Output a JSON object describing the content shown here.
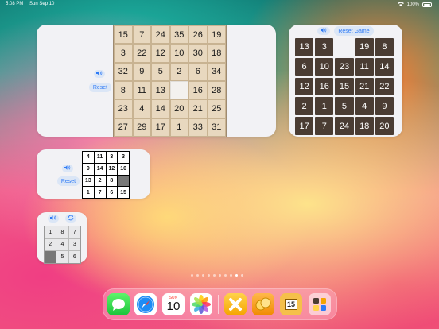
{
  "status_bar": {
    "time": "5:08 PM",
    "date": "Sun Sep 10",
    "battery": "100%"
  },
  "widget1": {
    "reset_label": "Reset",
    "board": [
      "15",
      "7",
      "24",
      "35",
      "26",
      "19",
      "3",
      "22",
      "12",
      "10",
      "30",
      "18",
      "32",
      "9",
      "5",
      "2",
      "6",
      "34",
      "8",
      "11",
      "13",
      "",
      "16",
      "28",
      "23",
      "4",
      "14",
      "20",
      "21",
      "25",
      "27",
      "29",
      "17",
      "1",
      "33",
      "31"
    ]
  },
  "widget2": {
    "reset_label": "Reset Game",
    "board": [
      "13",
      "3",
      "",
      "19",
      "8",
      "6",
      "10",
      "23",
      "11",
      "14",
      "12",
      "16",
      "15",
      "21",
      "22",
      "2",
      "1",
      "5",
      "4",
      "9",
      "17",
      "7",
      "24",
      "18",
      "20"
    ]
  },
  "widget3": {
    "reset_label": "Reset",
    "board": [
      "4",
      "11",
      "3",
      "3",
      "9",
      "14",
      "12",
      "10",
      "13",
      "2",
      "8",
      "",
      "1",
      "7",
      "6",
      "15"
    ]
  },
  "widget4": {
    "board": [
      "1",
      "8",
      "7",
      "2",
      "4",
      "3",
      "",
      "5",
      "6"
    ]
  },
  "page_indicator": {
    "count": 10,
    "active_index": 8
  },
  "dock": {
    "calendar_weekday": "SUN",
    "calendar_day": "10",
    "puzzle_badge": "15"
  }
}
